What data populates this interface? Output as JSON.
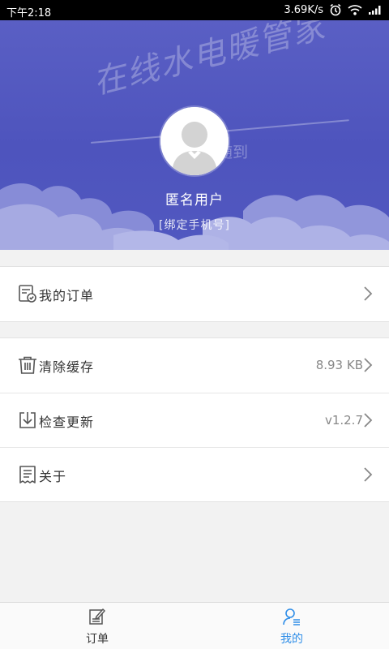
{
  "status_bar": {
    "time": "下午2:18",
    "network_speed": "3.69K/s"
  },
  "header": {
    "slogan": "在线水电暖管家",
    "slogan_sub": "随到",
    "user_name": "匿名用户",
    "bind_phone": "[绑定手机号]"
  },
  "menu": {
    "orders": {
      "label": "我的订单",
      "icon": "order-check-icon"
    },
    "clear_cache": {
      "label": "清除缓存",
      "value": "8.93 KB",
      "icon": "trash-icon"
    },
    "check_update": {
      "label": "检查更新",
      "value": "v1.2.7",
      "icon": "download-box-icon"
    },
    "about": {
      "label": "关于",
      "icon": "document-icon"
    }
  },
  "bottom_nav": {
    "tabs": [
      {
        "label": "订单",
        "icon": "order-edit-icon",
        "active": false
      },
      {
        "label": "我的",
        "icon": "user-icon",
        "active": true
      }
    ]
  },
  "colors": {
    "header_bg": "#5a5fc4",
    "active_tab": "#2f8ee8",
    "status_progress": "#4caf50"
  }
}
